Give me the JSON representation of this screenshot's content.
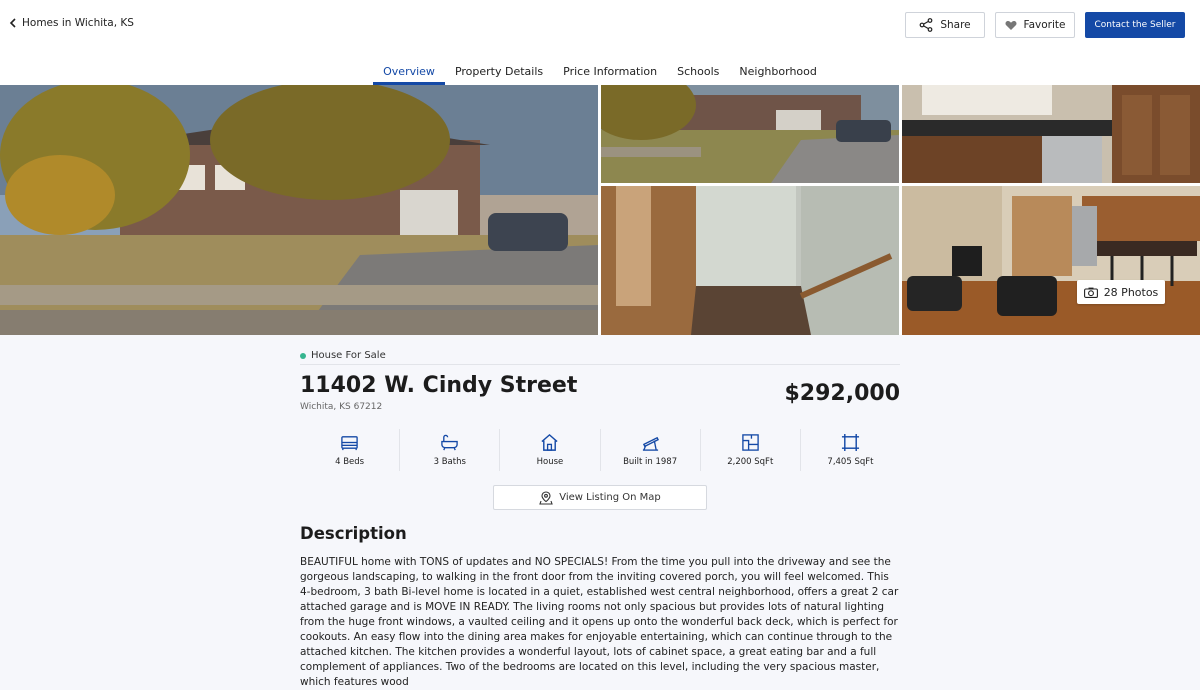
{
  "header": {
    "back_label": "Homes in Wichita, KS",
    "share_label": "Share",
    "favorite_label": "Favorite",
    "contact_label": "Contact the Seller"
  },
  "tabs": [
    {
      "label": "Overview",
      "active": true
    },
    {
      "label": "Property Details",
      "active": false
    },
    {
      "label": "Price Information",
      "active": false
    },
    {
      "label": "Schools",
      "active": false
    },
    {
      "label": "Neighborhood",
      "active": false
    }
  ],
  "gallery": {
    "photos_label": "28 Photos"
  },
  "listing": {
    "status": "House For Sale",
    "address": "11402 W. Cindy Street",
    "city_line": "Wichita, KS 67212",
    "price": "$292,000",
    "stats": [
      {
        "icon": "bed-icon",
        "label": "4 Beds"
      },
      {
        "icon": "bath-icon",
        "label": "3 Baths"
      },
      {
        "icon": "house-icon",
        "label": "House"
      },
      {
        "icon": "calendar-hammer-icon",
        "label": "Built in 1987"
      },
      {
        "icon": "floorplan-icon",
        "label": "2,200 SqFt"
      },
      {
        "icon": "lot-size-icon",
        "label": "7,405 SqFt"
      }
    ],
    "map_label": "View Listing On Map"
  },
  "description": {
    "heading": "Description",
    "text": "BEAUTIFUL home with TONS of updates and NO SPECIALS! From the time you pull into the driveway and see the gorgeous landscaping, to walking in the front door from the inviting covered porch, you will feel welcomed. This 4-bedroom, 3 bath Bi-level home is located in a quiet, established west central neighborhood, offers a great 2 car attached garage and is MOVE IN READY. The living rooms not only spacious but provides lots of natural lighting from the huge front windows, a vaulted ceiling and it opens up onto the wonderful back deck, which is perfect for cookouts. An easy flow into the dining area makes for enjoyable entertaining, which can continue through to the attached kitchen. The kitchen provides a wonderful layout, lots of cabinet space, a great eating bar and a full complement of appliances. Two of the bedrooms are located on this level, including the very spacious master, which features wood"
  },
  "colors": {
    "accent": "#1449a6",
    "status_dot": "#36b58f",
    "background": "#f6f7fb"
  }
}
